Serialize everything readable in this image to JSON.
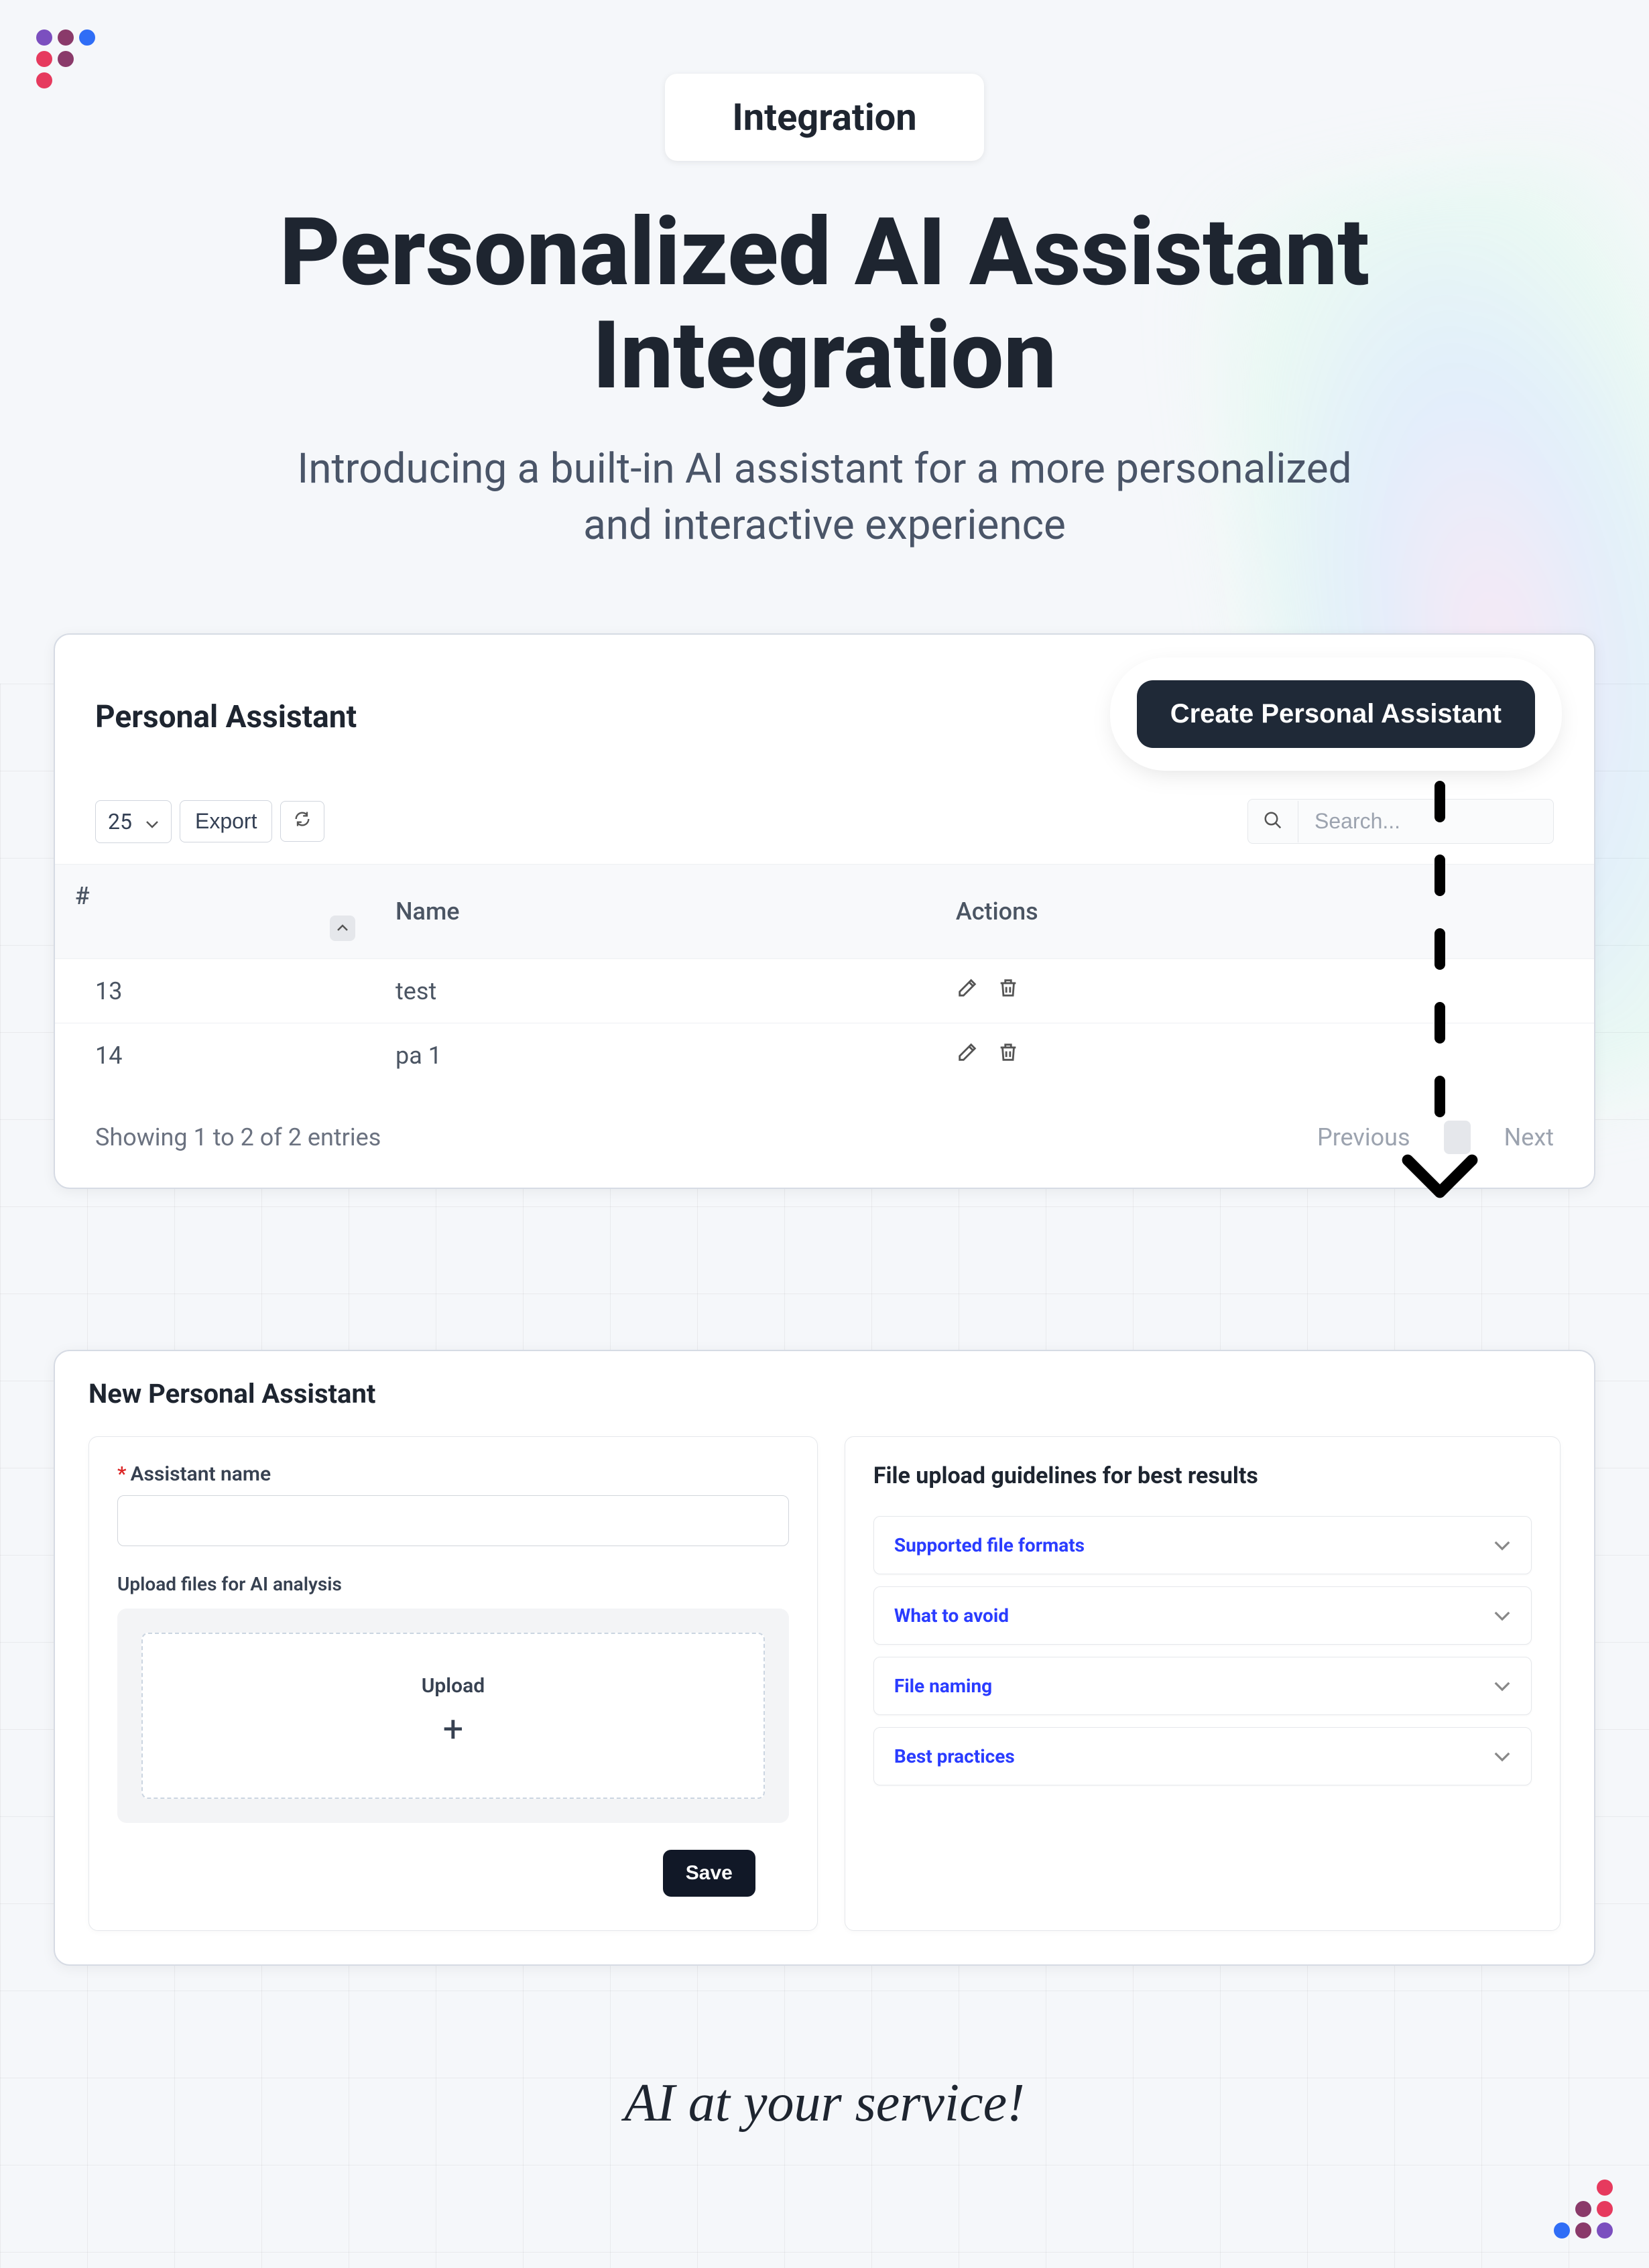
{
  "hero": {
    "badge": "Integration",
    "title_line1": "Personalized AI Assistant",
    "title_line2": "Integration",
    "subtitle_line1": "Introducing a built-in AI assistant for a more personalized",
    "subtitle_line2": "and interactive experience"
  },
  "panel1": {
    "title": "Personal Assistant",
    "create_btn": "Create Personal Assistant",
    "page_size": "25",
    "export": "Export",
    "search_placeholder": "Search...",
    "columns": {
      "num": "#",
      "name": "Name",
      "actions": "Actions"
    },
    "rows": [
      {
        "num": "13",
        "name": "test"
      },
      {
        "num": "14",
        "name": "pa 1"
      }
    ],
    "footer_text": "Showing 1 to 2 of 2 entries",
    "prev": "Previous",
    "next": "Next"
  },
  "panel2": {
    "title": "New Personal Assistant",
    "name_label": "Assistant name",
    "upload_label": "Upload files for AI analysis",
    "upload_text": "Upload",
    "guidelines_title": "File upload guidelines for best results",
    "accordion": [
      "Supported file formats",
      "What to avoid",
      "File naming",
      "Best practices"
    ],
    "save": "Save"
  },
  "tagline": "AI at your service!",
  "colors": {
    "purple": "#7b4fbf",
    "blue": "#2f6df6",
    "magenta": "#8a3a6a",
    "red": "#e63a5e"
  }
}
